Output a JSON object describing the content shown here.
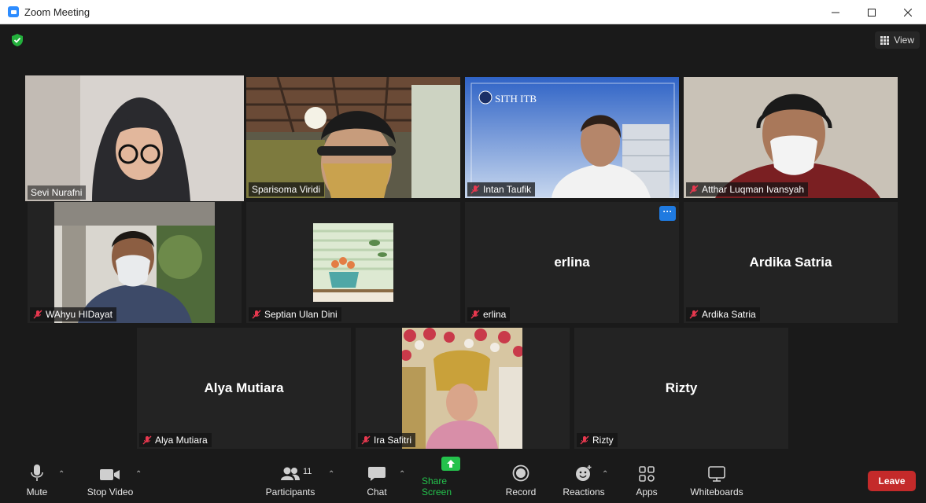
{
  "window": {
    "title": "Zoom Meeting",
    "icon": "zoom-camera-icon"
  },
  "meeting": {
    "view_label": "View",
    "security": "shield-check-icon"
  },
  "participants": [
    {
      "name": "Sevi Nurafni",
      "muted": false,
      "video": true,
      "active_speaker": true
    },
    {
      "name": "Sparisoma Viridi",
      "muted": false,
      "video": true
    },
    {
      "name": "Intan Taufik",
      "muted": true,
      "video": true,
      "background_text": "SITH ITB"
    },
    {
      "name": "Atthar Luqman Ivansyah",
      "muted": true,
      "video": true
    },
    {
      "name": "WAhyu HIDayat",
      "muted": true,
      "video": true
    },
    {
      "name": "Septian Ulan Dini",
      "muted": true,
      "video": false,
      "avatar": "plant-illustration"
    },
    {
      "name": "erlina",
      "muted": true,
      "video": false,
      "display": "erlina"
    },
    {
      "name": "Ardika Satria",
      "muted": true,
      "video": false,
      "display": "Ardika Satria"
    },
    {
      "name": "Alya Mutiara",
      "muted": true,
      "video": false,
      "display": "Alya Mutiara"
    },
    {
      "name": "Ira Safitri",
      "muted": true,
      "video": true
    },
    {
      "name": "Rizty",
      "muted": true,
      "video": false,
      "display": "Rizty"
    }
  ],
  "toolbar": {
    "mute": "Mute",
    "stop_video": "Stop Video",
    "participants": "Participants",
    "participants_count": "11",
    "chat": "Chat",
    "share_screen": "Share Screen",
    "record": "Record",
    "reactions": "Reactions",
    "apps": "Apps",
    "whiteboards": "Whiteboards",
    "leave": "Leave"
  },
  "colors": {
    "accent": "#2d8cff",
    "share_green": "#24c24c",
    "leave_red": "#c42a2a",
    "speaker_outline": "#e3e37a"
  }
}
